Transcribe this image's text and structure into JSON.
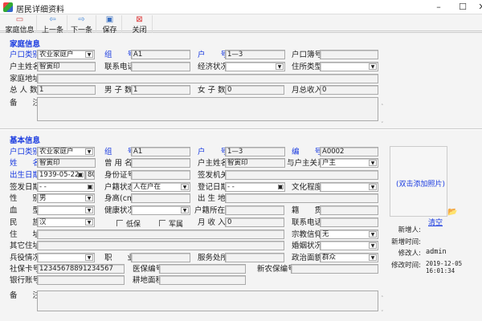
{
  "window": {
    "title": "居民详细资料",
    "min": "–",
    "max": "☐",
    "close": "✕"
  },
  "toolbar": {
    "family_info": "家庭信息",
    "prev": "上一条",
    "next": "下一条",
    "save": "保存",
    "close": "关闭"
  },
  "family": {
    "title": "家庭信息",
    "hukou_type_label": "户口类别",
    "hukou_type": "农业家庭户",
    "group_label": "组　　号",
    "group": "A1",
    "group_btn": "...",
    "household_no_label": "户　　号",
    "household_no": "1—3",
    "book_no_label": "户口簿号",
    "book_no": "",
    "head_name_label": "户主姓名",
    "head_name": "智寅印",
    "phone_label": "联系电话",
    "phone": "",
    "econ_label": "经济状况",
    "econ": "",
    "residence_type_label": "住所类型",
    "residence_type": "",
    "address_label": "家庭地址",
    "address": "",
    "total_label": "总 人 数",
    "total": "1",
    "male_label": "男 子 数",
    "male": "1",
    "female_label": "女 子 数",
    "female": "0",
    "income_label": "月总收入",
    "income": "0",
    "remarks_label": "备　　注",
    "remarks": ""
  },
  "basic": {
    "title": "基本信息",
    "hukou_type_label": "户口类别",
    "hukou_type": "农业家庭户",
    "group_label": "组　　号",
    "group": "A1",
    "household_no_label": "户　　号",
    "household_no": "1—3",
    "code_label": "编　　号",
    "code": "A0002",
    "name_label": "姓　　名",
    "name": "智寅印",
    "former_name_label": "曾 用 名",
    "former_name": "",
    "head_name_label": "户主姓名",
    "head_name": "智寅印",
    "relation_label": "与户主关系",
    "relation": "户主",
    "birth_label": "出生日期",
    "birth": "1939-05-22",
    "age": "80",
    "id_label": "身份证号",
    "id": "",
    "issuer_label": "签发机关",
    "issuer": "",
    "issue_date_label": "签发日期",
    "issue_date": "  -  -",
    "hukou_status_label": "户籍状态",
    "hukou_status": "人在户在",
    "reg_date_label": "登记日期",
    "reg_date": "  -  -",
    "education_label": "文化程度",
    "education": "",
    "sex_label": "性　　别",
    "sex": "男",
    "height_label": "身高(cm)",
    "height": "",
    "birthplace_label": "出 生 地",
    "birthplace": "",
    "blood_label": "血　　型",
    "blood": "",
    "health_label": "健康状况",
    "health": "",
    "hukou_place_label": "户籍所在地",
    "hukou_place": "",
    "native_label": "籍　　贯",
    "native": "",
    "ethnic_label": "民　　族",
    "ethnic": "汉",
    "dibao_label": "低保",
    "dibao_checked": false,
    "military_family_label": "军属",
    "military_family_checked": false,
    "income_label": "月 收 入",
    "income": "0",
    "phone_label": "联系电话",
    "phone": "",
    "address_label": "住　　址",
    "address": "",
    "religion_label": "宗教信仰",
    "religion": "无",
    "other_address_label": "其它住址",
    "other_address": "",
    "marital_label": "婚姻状况",
    "marital": "",
    "service_label": "兵役情况",
    "service": "",
    "job_label": "职　　业",
    "job": "",
    "workplace_label": "服务处所",
    "workplace": "",
    "political_label": "政治面貌",
    "political": "群众",
    "social_card_label": "社保卡号",
    "social_card": "12345678891234567",
    "medical_label": "医保编号",
    "medical": "",
    "rural_ins_label": "新农保编号",
    "rural_ins": "",
    "bank_label": "银行账号",
    "bank": "",
    "land_label": "耕地面积",
    "land": "",
    "remarks_label": "备　　注",
    "remarks": ""
  },
  "photo": {
    "hint": "(双击添加照片)",
    "clear": "清空"
  },
  "meta": {
    "creator_label": "新增人:",
    "creator": "",
    "created_label": "新增时间:",
    "created": "",
    "modifier_label": "修改人:",
    "modifier": "admin",
    "modified_label": "修改时间:",
    "modified": "2019-12-05 16:01:34"
  },
  "colors": {
    "label_blue": "#1a3be0",
    "background": "#f4f4f4"
  }
}
